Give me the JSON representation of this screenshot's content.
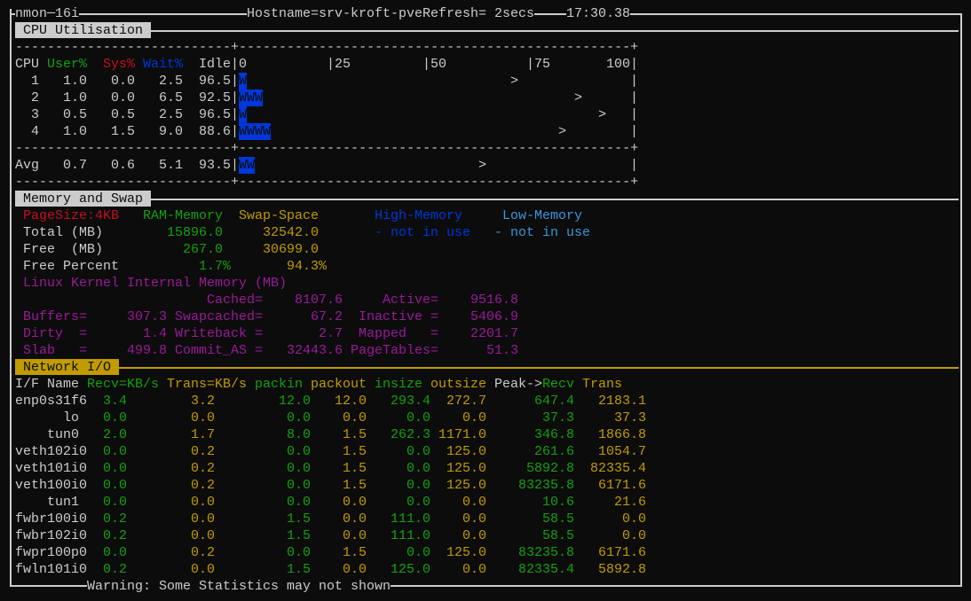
{
  "colors": {
    "text": "#cccccc",
    "green": "#13a10e",
    "red": "#c50f1f",
    "blue": "#0037da",
    "cyan": "#3a96dd",
    "orange": "#c19c00",
    "magenta": "#9a1a9a",
    "background": "#0c0c0c"
  },
  "header": {
    "app": "nmon",
    "version": "16i",
    "hostname": "Hostname=srv-kroft-pve",
    "refresh": "Refresh= 2secs",
    "time": "17:30.38"
  },
  "cpu": {
    "title": "CPU Utilisation",
    "columns": {
      "cpu": "CPU",
      "user": "User%",
      "sys": "Sys%",
      "wait": "Wait%",
      "idle": "Idle"
    },
    "scale": [
      "0",
      "|25",
      "|50",
      "|75",
      "100"
    ],
    "peak_symbol": ">",
    "rows": [
      {
        "cpu": "1",
        "user": "1.0",
        "sys": "0.0",
        "wait": "2.5",
        "idle": "96.5",
        "bar": "W",
        "peak_percent": 68
      },
      {
        "cpu": "2",
        "user": "1.0",
        "sys": "0.0",
        "wait": "6.5",
        "idle": "92.5",
        "bar": "WWW",
        "peak_percent": 84
      },
      {
        "cpu": "3",
        "user": "0.5",
        "sys": "0.5",
        "wait": "2.5",
        "idle": "96.5",
        "bar": "W",
        "peak_percent": 90
      },
      {
        "cpu": "4",
        "user": "1.0",
        "sys": "1.5",
        "wait": "9.0",
        "idle": "88.6",
        "bar": "WWWW",
        "peak_percent": 80
      }
    ],
    "avg": {
      "cpu": "Avg",
      "user": "0.7",
      "sys": "0.6",
      "wait": "5.1",
      "idle": "93.5",
      "bar": "WW",
      "peak_percent": 60
    }
  },
  "memory": {
    "title": "Memory and Swap",
    "pagesize": "PageSize:4KB",
    "ram_label": "RAM-Memory",
    "swap_label": "Swap-Space",
    "high_label": "High-Memory",
    "low_label": "Low-Memory",
    "total_label": "Total (MB)",
    "total_ram": "15896.0",
    "total_swap": "32542.0",
    "high_status": "- not in use",
    "low_status": "- not in use",
    "free_label": "Free  (MB)",
    "free_ram": "267.0",
    "free_swap": "30699.0",
    "freepct_label": "Free Percent",
    "freepct_ram": "1.7%",
    "freepct_swap": "94.3%",
    "kernel_title": "Linux Kernel Internal Memory (MB)",
    "kernel": {
      "cached_label": "Cached=",
      "cached": "8107.6",
      "active_label": "Active=",
      "active": "9516.8",
      "buffers_label": "Buffers=",
      "buffers": "307.3",
      "swapcached_label": "Swapcached=",
      "swapcached": "67.2",
      "inactive_label": "Inactive =",
      "inactive": "5406.9",
      "dirty_label": "Dirty  =",
      "dirty": "1.4",
      "writeback_label": "Writeback =",
      "writeback": "2.7",
      "mapped_label": "Mapped   =",
      "mapped": "2201.7",
      "slab_label": "Slab   =",
      "slab": "499.8",
      "commit_label": "Commit_AS =",
      "commit": "32443.6",
      "pagetables_label": "PageTables=",
      "pagetables": "51.3"
    }
  },
  "network": {
    "title": "Network I/O",
    "columns": {
      "name": "I/F Name",
      "recv": "Recv=KB/s",
      "trans": "Trans=KB/s",
      "packin": "packin",
      "packout": "packout",
      "insize": "insize",
      "outsize": "outsize",
      "peak": "Peak->",
      "peak_recv": "Recv",
      "peak_trans": "Trans"
    },
    "rows": [
      {
        "name": "enp0s31f6",
        "recv": "3.4",
        "trans": "3.2",
        "packin": "12.0",
        "packout": "12.0",
        "insize": "293.4",
        "outsize": "272.7",
        "peak_recv": "647.4",
        "peak_trans": "2183.1"
      },
      {
        "name": "lo",
        "recv": "0.0",
        "trans": "0.0",
        "packin": "0.0",
        "packout": "0.0",
        "insize": "0.0",
        "outsize": "0.0",
        "peak_recv": "37.3",
        "peak_trans": "37.3"
      },
      {
        "name": "tun0",
        "recv": "2.0",
        "trans": "1.7",
        "packin": "8.0",
        "packout": "1.5",
        "insize": "262.3",
        "outsize": "1171.0",
        "peak_recv": "346.8",
        "peak_trans": "1866.8"
      },
      {
        "name": "veth102i0",
        "recv": "0.0",
        "trans": "0.2",
        "packin": "0.0",
        "packout": "1.5",
        "insize": "0.0",
        "outsize": "125.0",
        "peak_recv": "261.6",
        "peak_trans": "1054.7"
      },
      {
        "name": "veth101i0",
        "recv": "0.0",
        "trans": "0.2",
        "packin": "0.0",
        "packout": "1.5",
        "insize": "0.0",
        "outsize": "125.0",
        "peak_recv": "5892.8",
        "peak_trans": "82335.4"
      },
      {
        "name": "veth100i0",
        "recv": "0.0",
        "trans": "0.2",
        "packin": "0.0",
        "packout": "1.5",
        "insize": "0.0",
        "outsize": "125.0",
        "peak_recv": "83235.8",
        "peak_trans": "6171.6"
      },
      {
        "name": "tun1",
        "recv": "0.0",
        "trans": "0.0",
        "packin": "0.0",
        "packout": "0.0",
        "insize": "0.0",
        "outsize": "0.0",
        "peak_recv": "10.6",
        "peak_trans": "21.6"
      },
      {
        "name": "fwbr100i0",
        "recv": "0.2",
        "trans": "0.0",
        "packin": "1.5",
        "packout": "0.0",
        "insize": "111.0",
        "outsize": "0.0",
        "peak_recv": "58.5",
        "peak_trans": "0.0"
      },
      {
        "name": "fwbr102i0",
        "recv": "0.2",
        "trans": "0.0",
        "packin": "1.5",
        "packout": "0.0",
        "insize": "111.0",
        "outsize": "0.0",
        "peak_recv": "58.5",
        "peak_trans": "0.0"
      },
      {
        "name": "fwpr100p0",
        "recv": "0.0",
        "trans": "0.2",
        "packin": "0.0",
        "packout": "1.5",
        "insize": "0.0",
        "outsize": "125.0",
        "peak_recv": "83235.8",
        "peak_trans": "6171.6"
      },
      {
        "name": "fwln101i0",
        "recv": "0.2",
        "trans": "0.0",
        "packin": "1.5",
        "packout": "0.0",
        "insize": "125.0",
        "outsize": "0.0",
        "peak_recv": "82335.4",
        "peak_trans": "5892.8"
      }
    ]
  },
  "footer": {
    "warning": "Warning: Some Statistics may not shown"
  }
}
